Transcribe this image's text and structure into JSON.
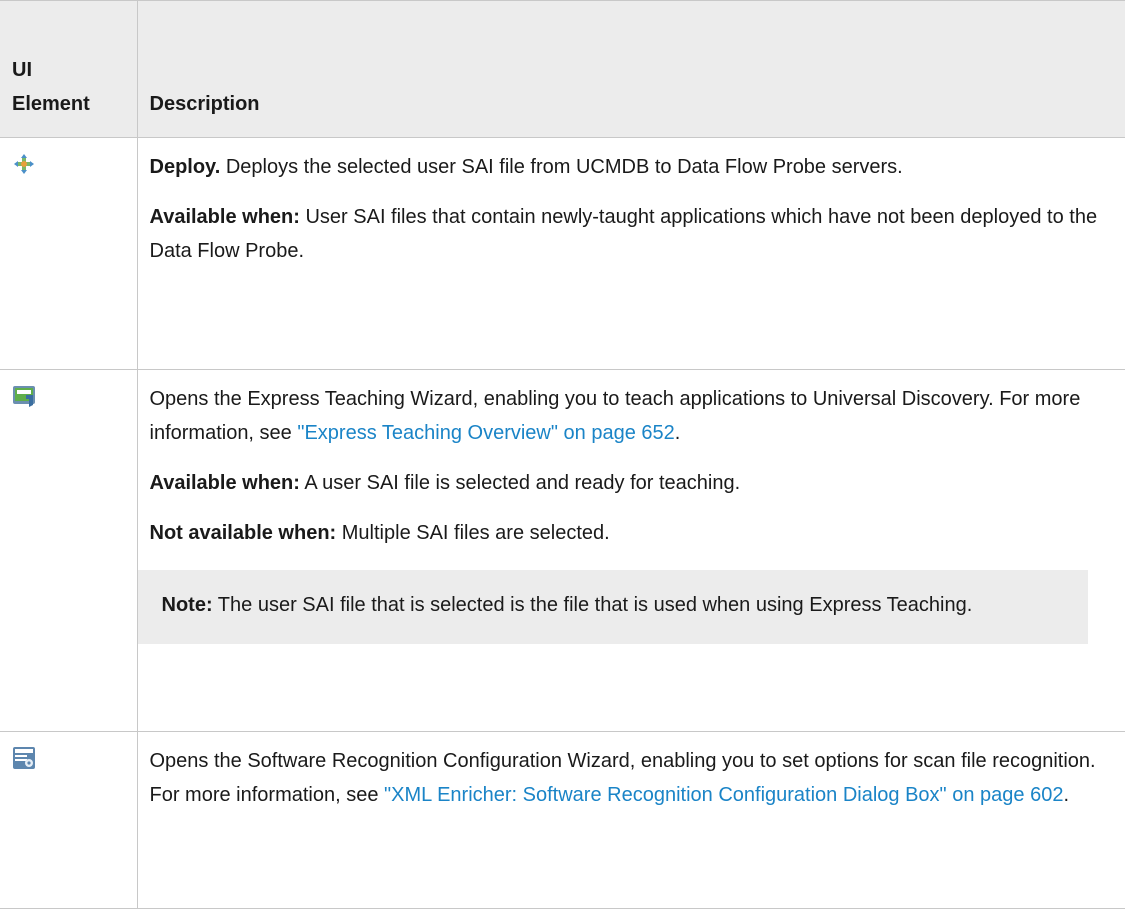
{
  "header": {
    "col1_line1": "UI",
    "col1_line2": "Element",
    "col2": "Description"
  },
  "rows": [
    {
      "icon": "deploy-icon",
      "title": "Deploy.",
      "text": " Deploys the selected user SAI file from UCMDB to Data Flow Probe servers.",
      "avail_label": "Available when:",
      "avail_text": " User SAI files that contain newly-taught applications which have not been deployed to the Data Flow Probe."
    },
    {
      "icon": "express-teaching-icon",
      "text": "Opens the Express Teaching Wizard, enabling you to teach applications to Universal Discovery. For more information, see ",
      "link": "\"Express Teaching Overview\" on page 652",
      "text_end": ".",
      "avail_label": "Available when:",
      "avail_text": " A user SAI file is selected and ready for teaching.",
      "notavail_label": "Not available when:",
      "notavail_text": "  Multiple SAI files are selected.",
      "note_label": "Note:",
      "note_text": " The user SAI file that is selected is the file that is used when using Express Teaching."
    },
    {
      "icon": "software-recognition-config-icon",
      "text": "Opens the Software Recognition Configuration Wizard, enabling you to set options for scan file recognition. For more information, see ",
      "link": "\"XML Enricher: Software Recognition Configuration Dialog Box\" on page 602",
      "text_end": "."
    }
  ],
  "colors": {
    "link": "#1a84c7",
    "header_bg": "#ececec",
    "border": "#c8c8c8"
  }
}
